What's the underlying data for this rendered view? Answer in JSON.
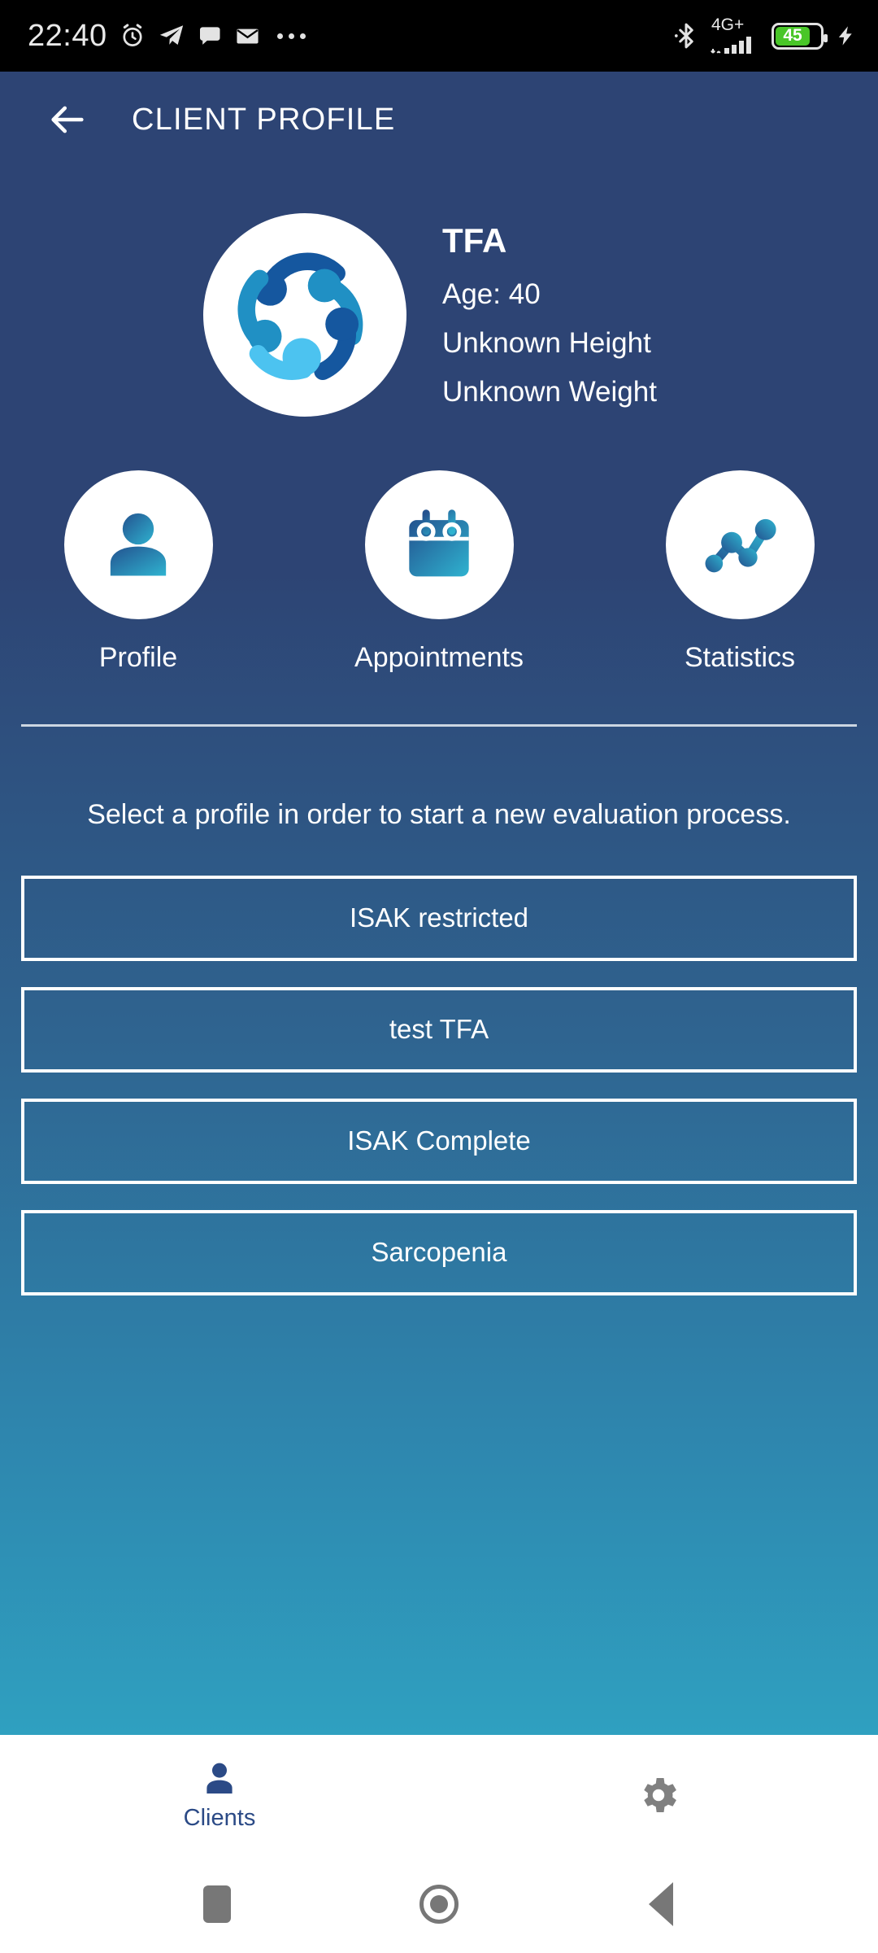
{
  "status_bar": {
    "time": "22:40",
    "left_icons": [
      "alarm-clock-icon",
      "telegram-icon",
      "chat-bubble-icon",
      "envelope-icon",
      "overflow-dots-icon"
    ],
    "network_label": "4G+",
    "battery_percent": "45",
    "battery_color": "#49c628",
    "right_icons": [
      "bluetooth-icon",
      "signal-bars-icon",
      "battery-icon",
      "charging-bolt-icon"
    ]
  },
  "app_bar": {
    "title": "CLIENT PROFILE",
    "back_icon": "arrow-left-icon"
  },
  "profile": {
    "avatar_icon": "network-pinwheel-logo",
    "name": "TFA",
    "age": "Age: 40",
    "height": "Unknown Height",
    "weight": "Unknown Weight"
  },
  "quick_actions": [
    {
      "label": "Profile",
      "icon": "person-icon"
    },
    {
      "label": "Appointments",
      "icon": "calendar-icon"
    },
    {
      "label": "Statistics",
      "icon": "line-chart-icon"
    }
  ],
  "prompt": "Select a profile in order to start a new evaluation process.",
  "evaluation_buttons": [
    {
      "label": "ISAK restricted"
    },
    {
      "label": "test TFA"
    },
    {
      "label": "ISAK Complete"
    },
    {
      "label": "Sarcopenia"
    }
  ],
  "tab_bar": [
    {
      "label": "Clients",
      "icon": "person-icon",
      "active": true
    },
    {
      "label": "",
      "icon": "gear-icon",
      "active": false
    }
  ],
  "android_nav": [
    {
      "icon": "recents-square-icon"
    },
    {
      "icon": "home-circle-icon"
    },
    {
      "icon": "back-triangle-icon"
    }
  ],
  "colors": {
    "header_bg": "#2d4474",
    "bottom_bg": "#2fa0c0",
    "accent": "#2b4a86",
    "icon_gradient_start": "#23528f",
    "icon_gradient_end": "#2ba9c9"
  }
}
